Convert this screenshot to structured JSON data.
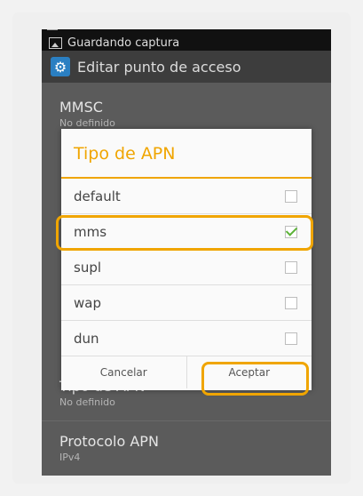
{
  "notification": {
    "text": "Guardando captura"
  },
  "actionbar": {
    "title": "Editar punto de acceso"
  },
  "settings": {
    "mmsc": {
      "label": "MMSC",
      "value": "No definido"
    },
    "apn_type": {
      "label": "Tipo de APN",
      "value": "No definido"
    },
    "apn_protocol": {
      "label": "Protocolo APN",
      "value": "IPv4"
    }
  },
  "dialog": {
    "title": "Tipo de APN",
    "options": [
      {
        "label": "default",
        "checked": false
      },
      {
        "label": "mms",
        "checked": true
      },
      {
        "label": "supl",
        "checked": false
      },
      {
        "label": "wap",
        "checked": false
      },
      {
        "label": "dun",
        "checked": false
      }
    ],
    "cancel_label": "Cancelar",
    "accept_label": "Aceptar"
  },
  "colors": {
    "accent": "#f0a500",
    "check": "#5cb338",
    "actionbar": "#3d3d3d"
  }
}
